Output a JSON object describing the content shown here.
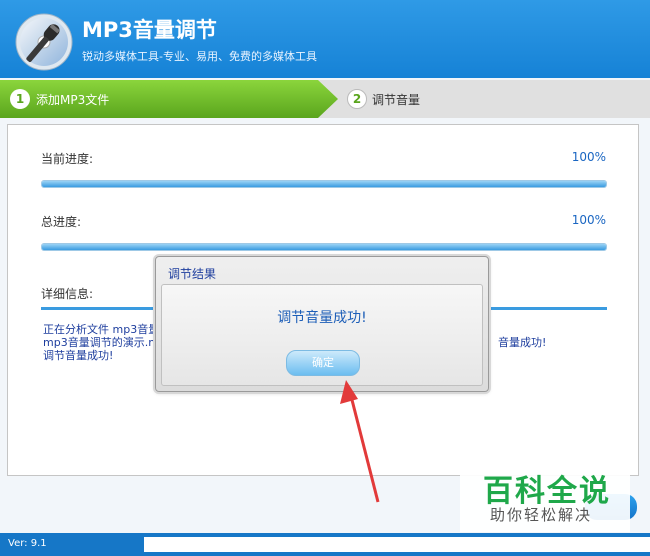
{
  "header": {
    "title": "MP3音量调节",
    "subtitle": "锐动多媒体工具-专业、易用、免费的多媒体工具"
  },
  "steps": [
    {
      "number": "1",
      "label": "添加MP3文件",
      "active": true
    },
    {
      "number": "2",
      "label": "调节音量",
      "active": false
    }
  ],
  "progress": {
    "current_label": "当前进度:",
    "current_value": "100%",
    "current_fraction": 1.0,
    "total_label": "总进度:",
    "total_value": "100%",
    "total_fraction": 1.0
  },
  "details": {
    "label": "详细信息:",
    "log_lines": [
      {
        "left": "正在分析文件 mp3音量",
        "right": ""
      },
      {
        "left": "mp3音量调节的演示.m",
        "right": "音量成功!"
      },
      {
        "left": "调节音量成功!",
        "right": ""
      }
    ]
  },
  "dialog": {
    "title": "调节结果",
    "message": "调节音量成功!",
    "ok_label": "确定"
  },
  "status": {
    "version": "Ver: 9.1"
  },
  "watermark": {
    "title": "百科全说",
    "subtitle": "助你轻松解决"
  },
  "colors": {
    "header_blue": "#1682d6",
    "step_green": "#5aa51d",
    "progress_blue": "#3a9be0",
    "annotation_red": "#e23a3a"
  }
}
